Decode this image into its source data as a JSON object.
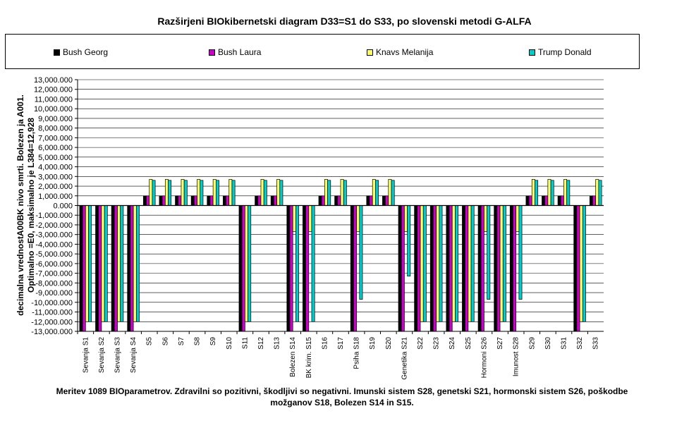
{
  "chart_data": {
    "type": "bar",
    "title": "Razširjeni BIOkibernetski diagram  D33=S1 do S33, po slovenski metodi G-ALFA",
    "ylabel_lines": [
      "decimalna vrednostA00BK nivo smrti. Bolezen ja A001.",
      "Optimalno =E0, maksimalno je L384=12,928"
    ],
    "footnote": "Meritev 1089 BIOparametrov. Zdravilni so pozitivni, škodljivi so negativni. Imunski sistem S28, genetski S21, hormonski sistem S26, poškodbe možganov S18, Bolezen S14 in S15.",
    "ylim": [
      -13000,
      13000
    ],
    "ytick_step": 1000,
    "grid": true,
    "legend_position": "top",
    "categories": [
      "Sevanja S1",
      "Sevanja S2",
      "Sevanja S3",
      "Sevanja S4",
      "S5",
      "S6",
      "S7",
      "S8",
      "S9",
      "S10",
      "S11",
      "S12",
      "S13",
      "Bolezen S14",
      "BK krim. S15",
      "S16",
      "S17",
      "Psiha S18",
      "S19",
      "S20",
      "Genetika S21",
      "S22",
      "S23",
      "S24",
      "S25",
      "Hormoni S26",
      "S27",
      "Imunost S28",
      "S29",
      "S30",
      "S31",
      "S32",
      "S33"
    ],
    "series": [
      {
        "name": "Bush Georg",
        "color": "#000000",
        "values": [
          -13000,
          -13000,
          -13000,
          -13000,
          1000,
          1000,
          1000,
          1000,
          1000,
          1000,
          -13000,
          1000,
          1000,
          -13000,
          -13000,
          1000,
          1000,
          -13000,
          1000,
          1000,
          -13000,
          -13000,
          -13000,
          -13000,
          -13000,
          -13000,
          -13000,
          -13000,
          1000,
          1000,
          1000,
          -13000,
          1000
        ]
      },
      {
        "name": "Bush Laura",
        "color": "#cc00cc",
        "values": [
          -13000,
          -13000,
          -13000,
          -13000,
          1000,
          1000,
          1000,
          1000,
          1000,
          1000,
          -13000,
          1000,
          1000,
          -13000,
          -13000,
          1000,
          1000,
          -13000,
          1000,
          1000,
          -13000,
          -13000,
          -13000,
          -13000,
          -13000,
          -13000,
          -13000,
          -13000,
          1000,
          1000,
          1000,
          -13000,
          1000
        ]
      },
      {
        "name": "Knavs Melanija",
        "color": "#ffff66",
        "values": [
          -12000,
          -12000,
          -12000,
          -12000,
          2700,
          2700,
          2700,
          2700,
          2700,
          2700,
          -12000,
          2700,
          2700,
          -2700,
          -2700,
          2700,
          2700,
          -2700,
          2700,
          2700,
          -2700,
          -12000,
          -12000,
          -12000,
          -12000,
          -2700,
          -12000,
          -2700,
          2700,
          2700,
          2700,
          -12000,
          2700
        ]
      },
      {
        "name": "Trump Donald",
        "color": "#00cccc",
        "values": [
          -12000,
          -12000,
          -12000,
          -12000,
          2600,
          2600,
          2600,
          2600,
          2600,
          2600,
          -12000,
          2600,
          2600,
          -12000,
          -12000,
          2600,
          2600,
          -9700,
          2600,
          2600,
          -7300,
          -12000,
          -12000,
          -12000,
          -12000,
          -9700,
          -12000,
          -9700,
          2600,
          2600,
          2600,
          -12000,
          2600
        ]
      }
    ]
  }
}
